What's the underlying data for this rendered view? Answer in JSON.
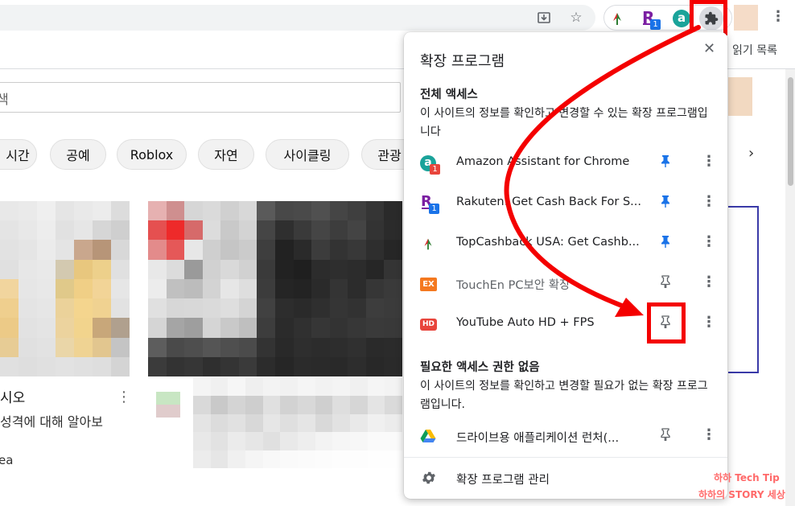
{
  "toolbar": {
    "reading_list": "읽기 목록",
    "ext_badge_rakuten": "1",
    "ext_badge_amazon": "1"
  },
  "youtube": {
    "search_placeholder_partial": "색",
    "chips": [
      "시간",
      "공예",
      "Roblox",
      "자연",
      "사이클링",
      "관광"
    ],
    "video_title": "시오",
    "video_subtitle": "성격에 대해 알아보",
    "video_channel": "ea"
  },
  "popup": {
    "title": "확장 프로그램",
    "section_full": "전체 액세스",
    "section_full_desc": "이 사이트의 정보를 확인하고 변경할 수 있는 확장 프로그램입니다",
    "section_none": "필요한 액세스 권한 없음",
    "section_none_desc": "이 사이트의 정보를 확인하고 변경할 필요가 없는 확장 프로그램입니다.",
    "extensions": [
      {
        "name": "Amazon Assistant for Chrome",
        "pinned": true,
        "icon": "amazon-icon",
        "badge": "1"
      },
      {
        "name": "Rakuten: Get Cash Back For S...",
        "pinned": true,
        "icon": "rakuten-icon",
        "badge": "1"
      },
      {
        "name": "TopCashback USA: Get Cashb...",
        "pinned": true,
        "icon": "topcashback-icon"
      },
      {
        "name": "TouchEn PC보안 확장",
        "pinned": false,
        "icon": "touchen-icon",
        "icon_text": "EX"
      },
      {
        "name": "YouTube Auto HD + FPS",
        "pinned": false,
        "icon": "youtube-auto-hd-icon",
        "icon_text": "HD"
      }
    ],
    "no_access_extensions": [
      {
        "name": "드라이브용 애플리케이션 런처(...",
        "pinned": false,
        "icon": "google-drive-icon"
      }
    ],
    "manage_label": "확장 프로그램 관리"
  },
  "watermark": {
    "line1": "하하 Tech Tip",
    "line2": "하하의 STORY 세상"
  },
  "colors": {
    "annotation_red": "#f40000",
    "pin_blue": "#1a73e8",
    "touchen_orange": "#f47920",
    "hd_red": "#e8453c"
  }
}
